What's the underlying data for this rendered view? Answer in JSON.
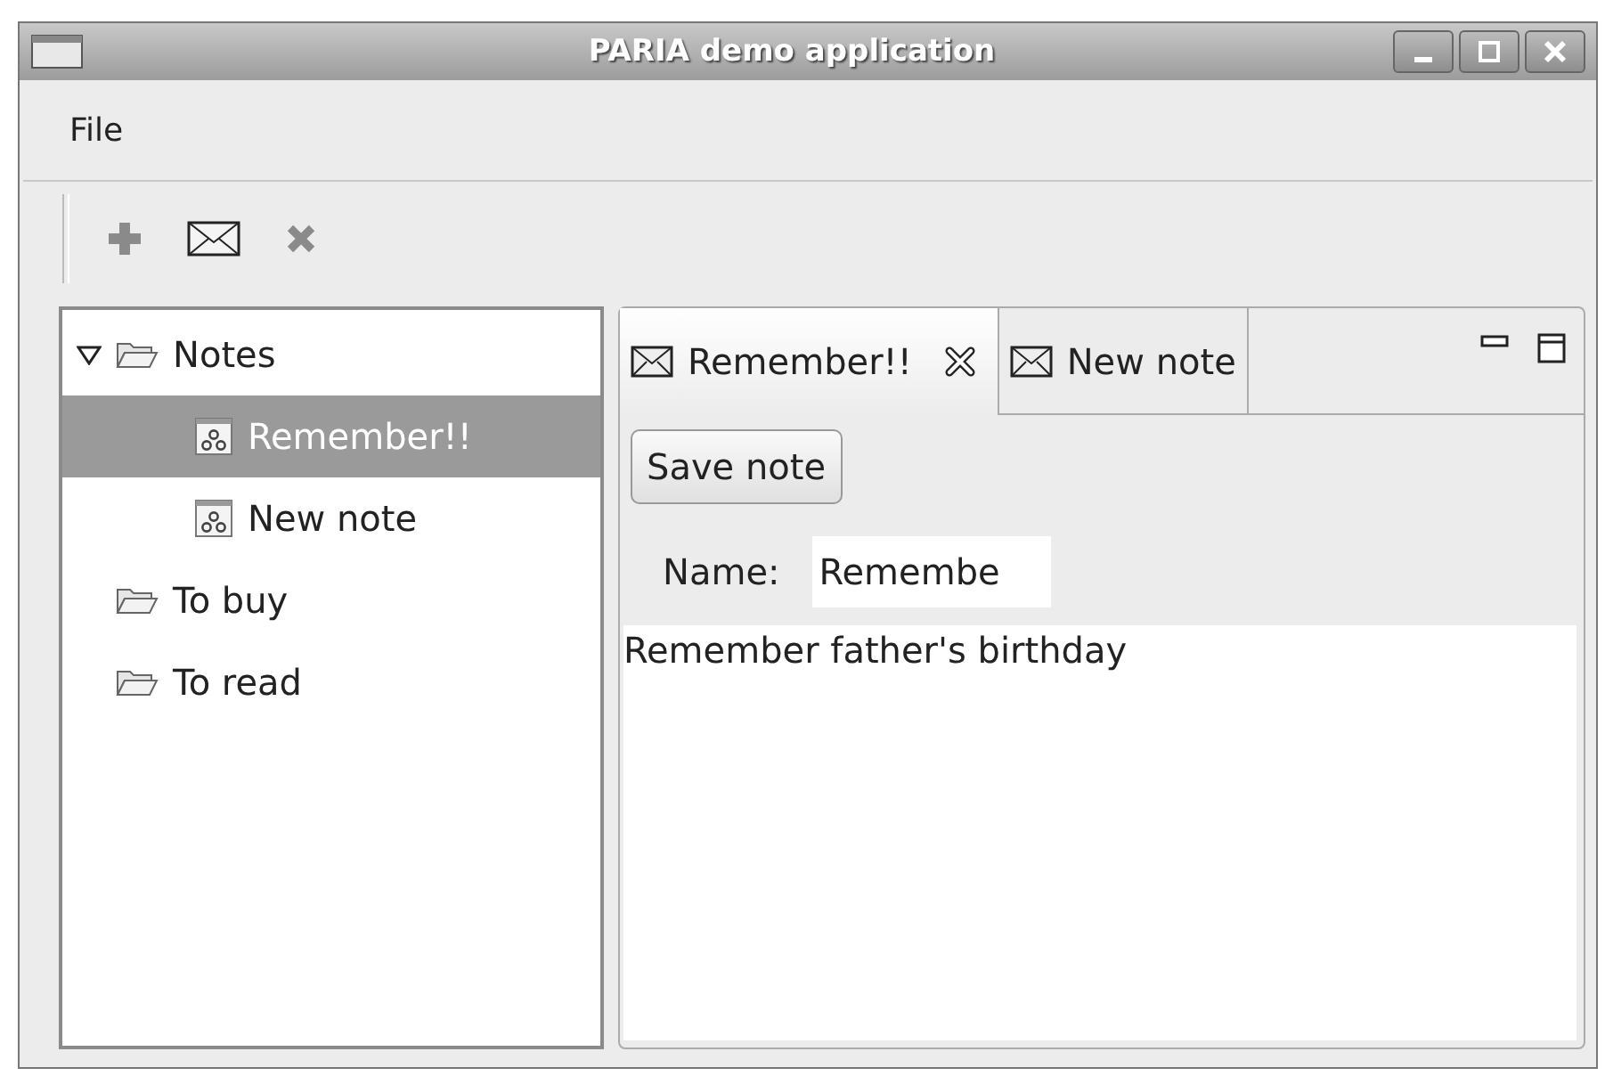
{
  "window": {
    "title": "PARIA demo application"
  },
  "menu": [
    "File"
  ],
  "toolbar": [
    {
      "kind": "add"
    },
    {
      "kind": "mail"
    },
    {
      "kind": "delete"
    }
  ],
  "tree": [
    {
      "label": "Notes",
      "kind": "folder",
      "selected": false,
      "expanded": true,
      "children": [
        {
          "label": "Remember!!",
          "kind": "note",
          "selected": true
        },
        {
          "label": "New note",
          "kind": "note",
          "selected": false
        }
      ]
    },
    {
      "label": "To buy",
      "kind": "folder",
      "selected": false
    },
    {
      "label": "To read",
      "kind": "folder",
      "selected": false
    }
  ],
  "tabs": [
    {
      "label": "Remember!!",
      "selected": true,
      "closable": true
    },
    {
      "label": "New note",
      "selected": false,
      "closable": false
    }
  ],
  "editor": {
    "save_button": "Save note",
    "name_label": "Name:",
    "name_value": "Remembe",
    "body": "Remember father's birthday"
  }
}
